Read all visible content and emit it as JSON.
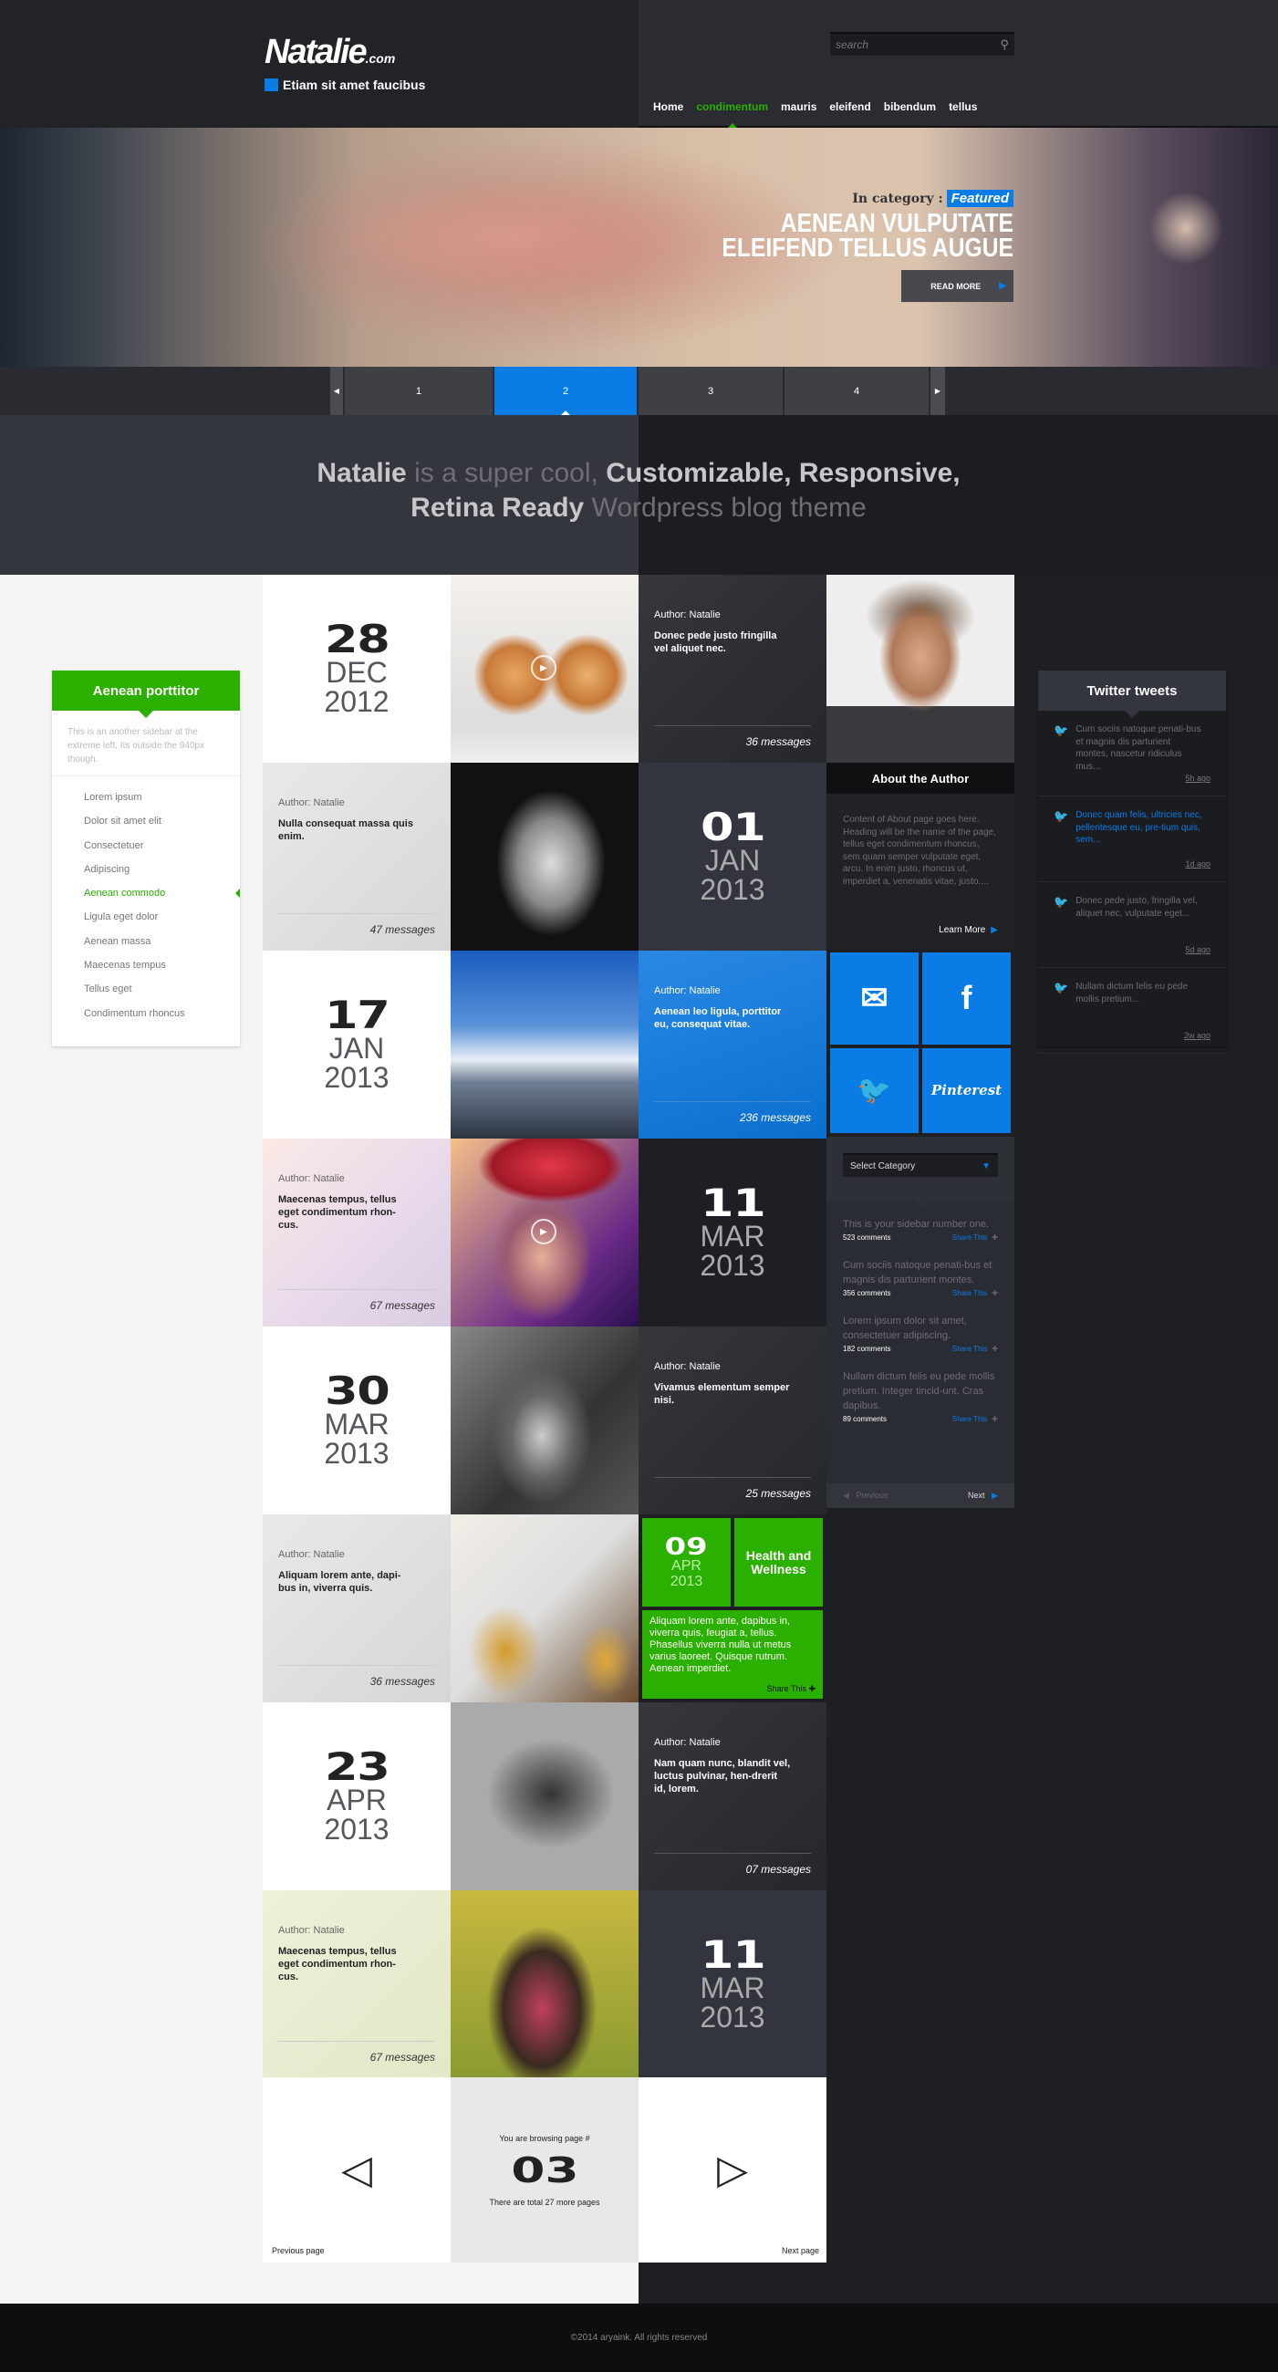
{
  "header": {
    "logo": "Natalie",
    "logo_suffix": ".com",
    "tagline": "Etiam sit amet faucibus",
    "search_placeholder": "search",
    "nav": [
      "Home",
      "condimentum",
      "mauris",
      "eleifend",
      "bibendum",
      "tellus"
    ],
    "nav_active": "condimentum"
  },
  "hero": {
    "category_label": "In category :",
    "category": "Featured",
    "title_line1": "AENEAN VULPUTATE",
    "title_line2": "ELEIFEND TELLUS AUGUE",
    "read_more": "READ MORE",
    "slides": [
      "1",
      "2",
      "3",
      "4"
    ],
    "active_slide": "2"
  },
  "intro": {
    "p1": "Natalie",
    "p2": " is a super cool, ",
    "p3": "Customizable, Responsive,",
    "p4": "Retina Ready",
    "p5": " Wordpress blog theme"
  },
  "grid": [
    [
      {
        "type": "date",
        "theme": "white",
        "day": "28",
        "month": "DEC",
        "year": "2012"
      },
      {
        "type": "image",
        "image": "kitten",
        "play": true
      },
      {
        "type": "post",
        "theme": "dark",
        "author": "Author: Natalie",
        "title": "Donec pede justo fringilla vel aliquet nec.",
        "messages": "36 messages"
      }
    ],
    [
      {
        "type": "post",
        "theme": "light",
        "author": "Author: Natalie",
        "title": "Nulla consequat massa quis enim.",
        "messages": "47 messages"
      },
      {
        "type": "image",
        "image": "bw"
      },
      {
        "type": "date",
        "theme": "dark",
        "day": "01",
        "month": "JAN",
        "year": "2013"
      }
    ],
    [
      {
        "type": "date",
        "theme": "white",
        "day": "17",
        "month": "JAN",
        "year": "2013"
      },
      {
        "type": "image",
        "image": "mountain"
      },
      {
        "type": "post",
        "theme": "blue",
        "author": "Author: Natalie",
        "title": "Aenean leo ligula, porttitor eu, consequat vitae.",
        "messages": "236 messages"
      }
    ],
    [
      {
        "type": "post",
        "theme": "pink",
        "author": "Author: Natalie",
        "title": "Maecenas tempus, tellus eget condimentum rhon-cus.",
        "messages": "67 messages"
      },
      {
        "type": "image",
        "image": "redhat",
        "play": true
      },
      {
        "type": "date",
        "theme": "black",
        "day": "11",
        "month": "MAR",
        "year": "2013"
      }
    ],
    [
      {
        "type": "date",
        "theme": "white",
        "day": "30",
        "month": "MAR",
        "year": "2013"
      },
      {
        "type": "image",
        "image": "bwface"
      },
      {
        "type": "post",
        "theme": "dark",
        "author": "Author: Natalie",
        "title": "Vivamus elementum semper nisi.",
        "messages": "25 messages"
      }
    ],
    [
      {
        "type": "post",
        "theme": "light",
        "author": "Author: Natalie",
        "title": "Aliquam lorem ante, dapi-bus in, viverra quis.",
        "messages": "36 messages"
      },
      {
        "type": "image",
        "image": "honey"
      },
      {
        "type": "green",
        "day": "09",
        "month": "APR",
        "year": "2013",
        "category": "Health and Wellness",
        "text": "Aliquam lorem ante, dapibus in, viverra quis, feugiat a, tellus. Phasellus viverra nulla ut metus varius laoreet. Quisque rutrum. Aenean imperdiet.",
        "share": "Share This"
      }
    ],
    [
      {
        "type": "date",
        "theme": "white",
        "day": "23",
        "month": "APR",
        "year": "2013"
      },
      {
        "type": "image",
        "image": "moto"
      },
      {
        "type": "post",
        "theme": "dark",
        "author": "Author: Natalie",
        "title": "Nam quam nunc, blandit vel, luctus pulvinar, hen-drerit id, lorem.",
        "messages": "07 messages"
      }
    ],
    [
      {
        "type": "post",
        "theme": "meadow",
        "author": "Author: Natalie",
        "title": "Maecenas tempus, tellus eget condimentum rhon-cus.",
        "messages": "67 messages"
      },
      {
        "type": "image",
        "image": "kids"
      },
      {
        "type": "date",
        "theme": "dark",
        "day": "11",
        "month": "MAR",
        "year": "2013"
      }
    ]
  ],
  "pagination": {
    "browsing": "You are browsing page #",
    "page": "03",
    "total": "There are total 27 more pages",
    "prev": "Previous page",
    "next": "Next page"
  },
  "about": {
    "title": "About the Author",
    "text": "Content of About page goes here. Heading will be the name of the page,  tellus eget condimentum rhoncus, sem quam semper vulputate eget, arcu. In enim justo, rhoncus ut, imperdiet a, venenatis vitae, justo....",
    "learn_more": "Learn More"
  },
  "social": [
    {
      "icon": "email-icon",
      "glyph": "✉"
    },
    {
      "icon": "facebook-icon",
      "glyph": "f"
    },
    {
      "icon": "twitter-icon",
      "glyph": "🐦"
    },
    {
      "icon": "pinterest-icon",
      "glyph": "Pinterest"
    }
  ],
  "categories": {
    "select": "Select Category",
    "entries": [
      {
        "text": "This is your sidebar number one.",
        "comments": "523 comments",
        "share": "Share This"
      },
      {
        "text": "Cum sociis natoque penati-bus et magnis dis parturient montes.",
        "comments": "356 comments",
        "share": "Share This"
      },
      {
        "text": "Lorem ipsum dolor sit amet, consectetuer adipiscing.",
        "comments": "182 comments",
        "share": "Share This"
      },
      {
        "text": "Nullam dictum felis eu pede mollis pretium. Integer tincid-unt. Cras dapibus.",
        "comments": "89 comments",
        "share": "Share This"
      }
    ],
    "previous": "Previous",
    "next": "Next"
  },
  "left_widget": {
    "title": "Aenean porttitor",
    "desc": "This is an another sidebar at the extreme left, Its outside the 940px though.",
    "items": [
      "Lorem ipsum",
      "Dolor sit amet elit",
      "Consectetuer",
      "Adipiscing",
      "Aenean commodo",
      "Ligula eget dolor",
      "Aenean massa",
      "Maecenas tempus",
      "Tellus eget",
      "Condimentum rhoncus"
    ],
    "active": "Aenean commodo"
  },
  "twitter": {
    "title": "Twitter tweets",
    "tweets": [
      {
        "text": "Cum sociis natoque penati-bus et magnis dis parturient montes, nascetur ridiculus mus...",
        "ago": "5h ago"
      },
      {
        "text": "Donec quam felis, ultricies nec, pellentesque eu, pre-tium quis, sem...",
        "ago": "1d ago",
        "active": true
      },
      {
        "text": "Donec pede justo, fringilla vel, aliquet nec, vulputate eget...",
        "ago": "5d ago"
      },
      {
        "text": "Nullam dictum felis eu pede mollis pretium...",
        "ago": "2w ago"
      }
    ]
  },
  "footer": {
    "copyright": "©2014 aryaink. All rights reserved"
  },
  "colors": {
    "accent_blue": "#0a7ce5",
    "accent_green": "#2cb000",
    "dark": "#1e1f23"
  }
}
